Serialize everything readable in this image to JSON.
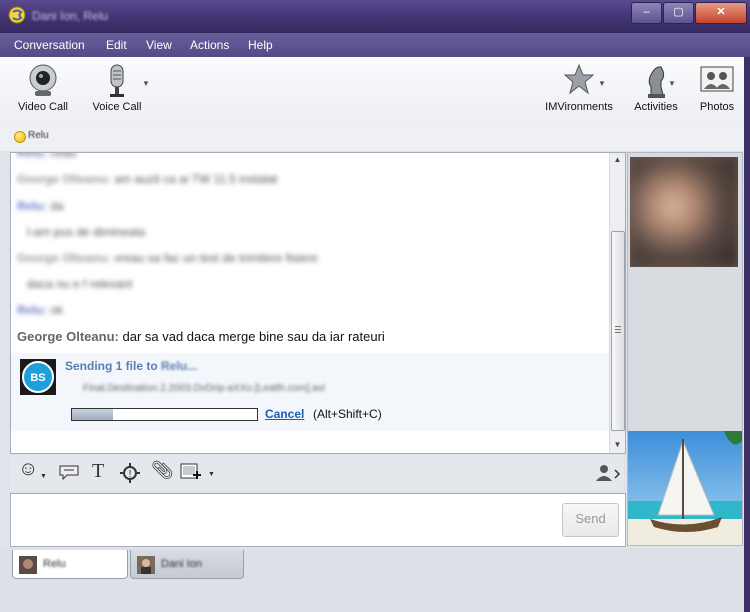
{
  "window": {
    "title": "Dani Ion, Relu",
    "controls": [
      "–",
      "▢",
      "✕"
    ]
  },
  "menu": [
    "Conversation",
    "Edit",
    "View",
    "Actions",
    "Help"
  ],
  "toolbar": {
    "video_call": "Video Call",
    "voice_call": "Voice Call",
    "imvironments": "IMVironments",
    "activities": "Activities",
    "photos": "Photos"
  },
  "status": {
    "name": "Relu"
  },
  "messages": [
    {
      "name": "Relu:",
      "text": "ceau",
      "blurred": true,
      "nameColor": "#6b7cc7"
    },
    {
      "name": "George Olteanu:",
      "text": "am auzit ca ai TW 11.5 instalat",
      "blurred": true,
      "nameColor": "#9a9a9a"
    },
    {
      "name": "Relu:",
      "text": "da",
      "blurred": true,
      "nameColor": "#6b7cc7"
    },
    {
      "name": "",
      "text": "l-am pus de dimineata",
      "blurred": true
    },
    {
      "name": "George Olteanu:",
      "text": "vreau sa fac un test de trimitere fisiere",
      "blurred": true,
      "nameColor": "#9a9a9a"
    },
    {
      "name": "",
      "text": "daca nu e f relevant",
      "blurred": true
    },
    {
      "name": "Relu:",
      "text": "ok",
      "blurred": true,
      "nameColor": "#6b7cc7"
    },
    {
      "name": "George Olteanu:",
      "text": "dar sa vad daca merge bine sau da iar rateuri",
      "blurred": false
    }
  ],
  "transfer": {
    "sending_prefix": "Sending 1 file to",
    "recipient": "Relu...",
    "filename": "Final.Destination.2.2003.DvDrip-aXXo.[Lealth.com].avi",
    "progress": 0.22,
    "cancel": "Cancel",
    "shortcut": "(Alt+Shift+C)",
    "logo": "BS"
  },
  "send_label": "Send",
  "tabs": [
    {
      "name": "Relu",
      "active": true
    },
    {
      "name": "Dani Ion",
      "active": false
    }
  ],
  "colors": {
    "titlebar": "#3f3270",
    "link": "#1b5fb5",
    "accent": "#5b5fa8"
  }
}
